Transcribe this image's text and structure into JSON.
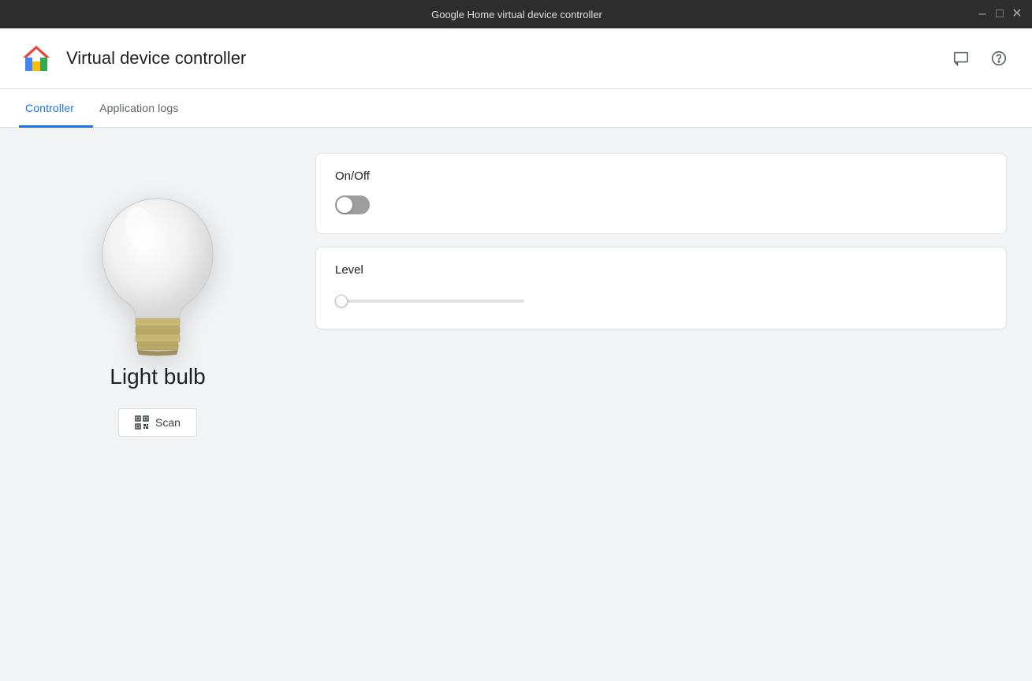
{
  "titleBar": {
    "title": "Google Home virtual device controller",
    "minimize": "–",
    "maximize": "□",
    "close": "✕"
  },
  "header": {
    "appTitle": "Virtual device controller",
    "feedbackIconLabel": "feedback-icon",
    "helpIconLabel": "help-icon"
  },
  "tabs": [
    {
      "id": "controller",
      "label": "Controller",
      "active": true
    },
    {
      "id": "application-logs",
      "label": "Application logs",
      "active": false
    }
  ],
  "leftPanel": {
    "deviceName": "Light bulb",
    "scanButton": "Scan"
  },
  "controls": [
    {
      "id": "on-off",
      "label": "On/Off",
      "type": "toggle",
      "value": false
    },
    {
      "id": "level",
      "label": "Level",
      "type": "slider",
      "value": 0,
      "min": 0,
      "max": 100
    }
  ],
  "colors": {
    "accent": "#1a73e8",
    "toggleOff": "#9e9e9e",
    "toggleOn": "#1a73e8"
  }
}
